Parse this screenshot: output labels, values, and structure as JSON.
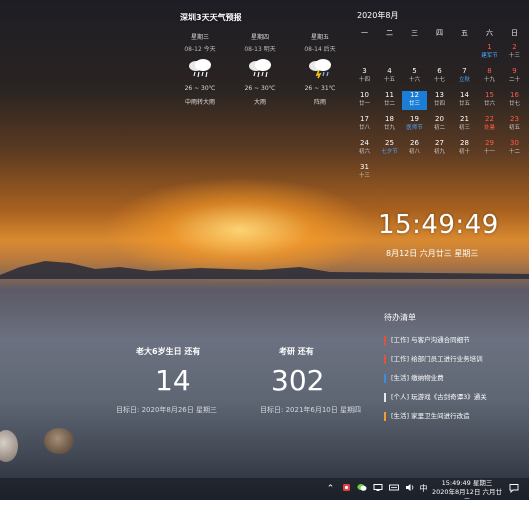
{
  "weather": {
    "title": "深圳3天天气预报",
    "days": [
      {
        "weekday": "星期三",
        "date": "08-12 今天",
        "icon": "cloudy-rain-icon",
        "temp": "26 ~ 30℃",
        "desc": "中雨转大雨"
      },
      {
        "weekday": "星期四",
        "date": "08-13 明天",
        "icon": "cloudy-rain-icon",
        "temp": "26 ~ 30℃",
        "desc": "大雨"
      },
      {
        "weekday": "星期五",
        "date": "08-14 后天",
        "icon": "thunderstorm-icon",
        "temp": "26 ~ 31℃",
        "desc": "阵雨"
      }
    ]
  },
  "calendar": {
    "title": "2020年8月",
    "weekdays": [
      "一",
      "二",
      "三",
      "四",
      "五",
      "六",
      "日"
    ],
    "weeks": [
      [
        null,
        null,
        null,
        null,
        null,
        {
          "d": "1",
          "l": "建军节",
          "dred": true,
          "lblue": true
        },
        {
          "d": "2",
          "l": "十三",
          "dred": true
        }
      ],
      [
        {
          "d": "3",
          "l": "十四"
        },
        {
          "d": "4",
          "l": "十五"
        },
        {
          "d": "5",
          "l": "十六"
        },
        {
          "d": "6",
          "l": "十七"
        },
        {
          "d": "7",
          "l": "立秋",
          "lblue": true
        },
        {
          "d": "8",
          "l": "十九",
          "dred": true
        },
        {
          "d": "9",
          "l": "二十",
          "dred": true
        }
      ],
      [
        {
          "d": "10",
          "l": "廿一"
        },
        {
          "d": "11",
          "l": "廿二"
        },
        {
          "d": "12",
          "l": "廿三",
          "sel": true
        },
        {
          "d": "13",
          "l": "廿四"
        },
        {
          "d": "14",
          "l": "廿五"
        },
        {
          "d": "15",
          "l": "廿六",
          "dred": true
        },
        {
          "d": "16",
          "l": "廿七",
          "dred": true
        }
      ],
      [
        {
          "d": "17",
          "l": "廿八"
        },
        {
          "d": "18",
          "l": "廿九"
        },
        {
          "d": "19",
          "l": "医师节",
          "lblue": true
        },
        {
          "d": "20",
          "l": "初二"
        },
        {
          "d": "21",
          "l": "初三"
        },
        {
          "d": "22",
          "l": "处暑",
          "dred": true,
          "lred": true
        },
        {
          "d": "23",
          "l": "初五",
          "dred": true
        }
      ],
      [
        {
          "d": "24",
          "l": "初六"
        },
        {
          "d": "25",
          "l": "七夕节",
          "lblue": true
        },
        {
          "d": "26",
          "l": "初八"
        },
        {
          "d": "27",
          "l": "初九"
        },
        {
          "d": "28",
          "l": "初十"
        },
        {
          "d": "29",
          "l": "十一",
          "dred": true
        },
        {
          "d": "30",
          "l": "十二",
          "dred": true
        }
      ],
      [
        {
          "d": "31",
          "l": "十三"
        },
        null,
        null,
        null,
        null,
        null,
        null
      ]
    ]
  },
  "clock": {
    "time": "15:49:49",
    "date": "8月12日 六月廿三 星期三"
  },
  "countdowns": [
    {
      "label": "老大6岁生日 还有",
      "days": "14",
      "target": "目标日: 2020年8月26日 星期三"
    },
    {
      "label": "考研 还有",
      "days": "302",
      "target": "目标日: 2021年6月10日 星期四"
    }
  ],
  "todo": {
    "title": "待办清单",
    "items": [
      {
        "text": "[工作] 与客户沟通合同细节",
        "color": "#e0533f"
      },
      {
        "text": "[工作] 给部门员工进行业务培训",
        "color": "#e0533f"
      },
      {
        "text": "[生活] 缴纳物业费",
        "color": "#3b8de0"
      },
      {
        "text": "[个人] 玩游戏《古剑奇谭3》通关",
        "color": "#e8e8e8"
      },
      {
        "text": "[生活] 家里卫生间进行改造",
        "color": "#f0a030"
      }
    ]
  },
  "taskbar": {
    "tray_icons": [
      "chevron-up-icon",
      "app-tray-icon",
      "wechat-icon",
      "network-icon",
      "keyboard-icon",
      "volume-icon"
    ],
    "ime": "中",
    "time": "15:49:49 星期三",
    "date": "2020年8月12日 六月廿三"
  }
}
